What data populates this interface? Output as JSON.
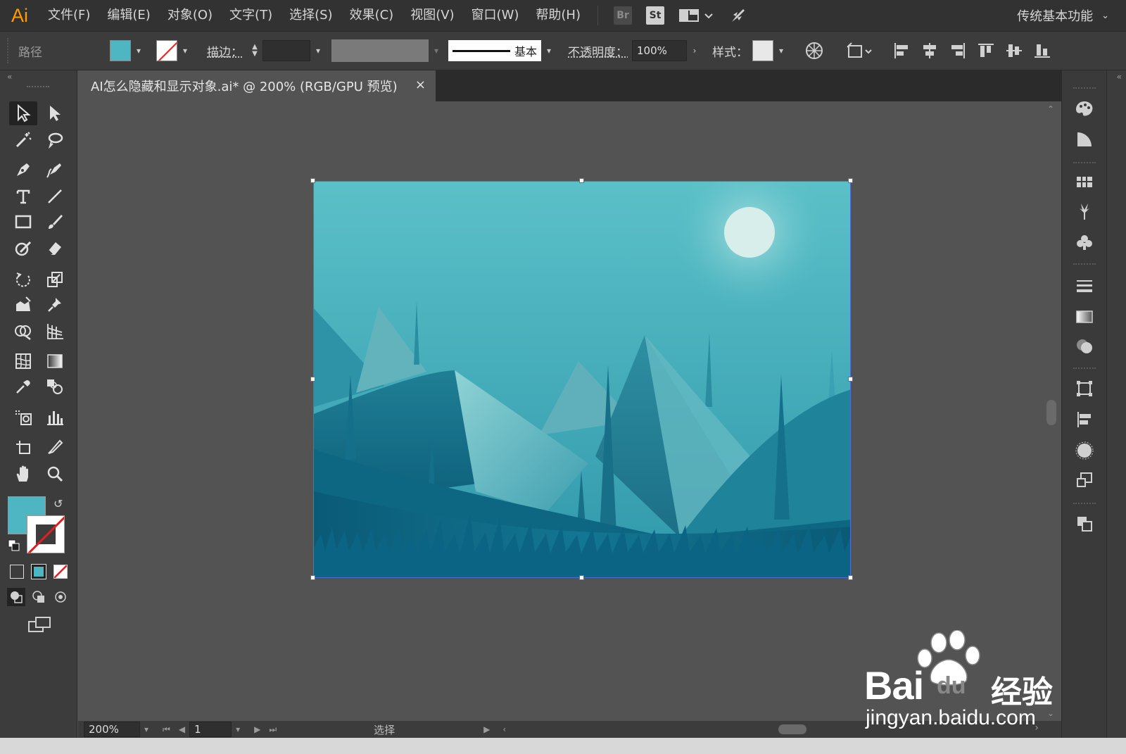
{
  "app": {
    "logo": "Ai",
    "workspace": "传统基本功能"
  },
  "menu": [
    "文件(F)",
    "编辑(E)",
    "对象(O)",
    "文字(T)",
    "选择(S)",
    "效果(C)",
    "视图(V)",
    "窗口(W)",
    "帮助(H)"
  ],
  "menubar_icons": {
    "bridge": "Br",
    "stock": "St"
  },
  "control": {
    "selection_label": "路径",
    "fill_color": "#4db6c2",
    "stroke_label": "描边：",
    "stroke_profile": "基本",
    "opacity_label": "不透明度：",
    "opacity_value": "100%",
    "style_label": "样式："
  },
  "document": {
    "tab_title": "AI怎么隐藏和显示对象.ai* @ 200% (RGB/GPU 预览)",
    "close": "×"
  },
  "status": {
    "zoom": "200%",
    "page": "1",
    "tool": "选择"
  },
  "watermark": {
    "brand": "Bai",
    "brand_cn": "经验",
    "url": "jingyan.baidu.com"
  },
  "colors": {
    "sky_top": "#5bc0c8",
    "sky_bottom": "#37a3b4",
    "moon": "#d8eeea",
    "ground": "#0b5f7c",
    "selection": "#4c6fd6"
  }
}
